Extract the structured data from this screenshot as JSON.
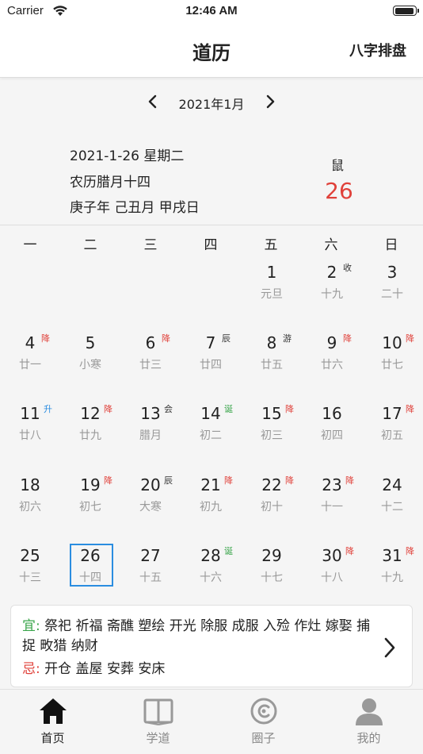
{
  "status_bar": {
    "carrier": "Carrier",
    "time": "12:46 AM"
  },
  "nav": {
    "title": "道历",
    "right_action": "八字排盘"
  },
  "month_bar": {
    "label": "2021年1月"
  },
  "day_info": {
    "solar": "2021-1-26 星期二",
    "lunar": "农历腊月十四",
    "ganzhi": "庚子年 己丑月 甲戌日",
    "zodiac": "鼠",
    "day": "26"
  },
  "weekdays": [
    "一",
    "二",
    "三",
    "四",
    "五",
    "六",
    "日"
  ],
  "calendar": [
    [
      null,
      null,
      null,
      null,
      {
        "day": "1",
        "lunar": "元旦",
        "badge": "",
        "badge_color": ""
      },
      {
        "day": "2",
        "lunar": "十九",
        "badge": "收",
        "badge_color": "black"
      },
      {
        "day": "3",
        "lunar": "二十",
        "badge": "",
        "badge_color": ""
      }
    ],
    [
      {
        "day": "4",
        "lunar": "廿一",
        "badge": "降",
        "badge_color": "red"
      },
      {
        "day": "5",
        "lunar": "小寒",
        "badge": "",
        "badge_color": ""
      },
      {
        "day": "6",
        "lunar": "廿三",
        "badge": "降",
        "badge_color": "red"
      },
      {
        "day": "7",
        "lunar": "廿四",
        "badge": "辰",
        "badge_color": "black"
      },
      {
        "day": "8",
        "lunar": "廿五",
        "badge": "游",
        "badge_color": "black"
      },
      {
        "day": "9",
        "lunar": "廿六",
        "badge": "降",
        "badge_color": "red"
      },
      {
        "day": "10",
        "lunar": "廿七",
        "badge": "降",
        "badge_color": "red"
      }
    ],
    [
      {
        "day": "11",
        "lunar": "廿八",
        "badge": "升",
        "badge_color": "blue"
      },
      {
        "day": "12",
        "lunar": "廿九",
        "badge": "降",
        "badge_color": "red"
      },
      {
        "day": "13",
        "lunar": "腊月",
        "badge": "会",
        "badge_color": "black"
      },
      {
        "day": "14",
        "lunar": "初二",
        "badge": "诞",
        "badge_color": "green"
      },
      {
        "day": "15",
        "lunar": "初三",
        "badge": "降",
        "badge_color": "red"
      },
      {
        "day": "16",
        "lunar": "初四",
        "badge": "",
        "badge_color": ""
      },
      {
        "day": "17",
        "lunar": "初五",
        "badge": "降",
        "badge_color": "red"
      }
    ],
    [
      {
        "day": "18",
        "lunar": "初六",
        "badge": "",
        "badge_color": ""
      },
      {
        "day": "19",
        "lunar": "初七",
        "badge": "降",
        "badge_color": "red"
      },
      {
        "day": "20",
        "lunar": "大寒",
        "badge": "辰",
        "badge_color": "black"
      },
      {
        "day": "21",
        "lunar": "初九",
        "badge": "降",
        "badge_color": "red"
      },
      {
        "day": "22",
        "lunar": "初十",
        "badge": "降",
        "badge_color": "red"
      },
      {
        "day": "23",
        "lunar": "十一",
        "badge": "降",
        "badge_color": "red"
      },
      {
        "day": "24",
        "lunar": "十二",
        "badge": "",
        "badge_color": ""
      }
    ],
    [
      {
        "day": "25",
        "lunar": "十三",
        "badge": "",
        "badge_color": ""
      },
      {
        "day": "26",
        "lunar": "十四",
        "badge": "",
        "badge_color": "",
        "selected": true
      },
      {
        "day": "27",
        "lunar": "十五",
        "badge": "",
        "badge_color": ""
      },
      {
        "day": "28",
        "lunar": "十六",
        "badge": "诞",
        "badge_color": "green"
      },
      {
        "day": "29",
        "lunar": "十七",
        "badge": "",
        "badge_color": ""
      },
      {
        "day": "30",
        "lunar": "十八",
        "badge": "降",
        "badge_color": "red"
      },
      {
        "day": "31",
        "lunar": "十九",
        "badge": "降",
        "badge_color": "red"
      }
    ]
  ],
  "yiji": {
    "yi_label": "宜:",
    "yi_text": "祭祀 祈福 斋醮 塑绘 开光 除服 成服 入殓 作灶 嫁娶 捕捉 畋猎 纳财",
    "ji_label": "忌:",
    "ji_text": "开仓 盖屋 安葬 安床"
  },
  "tabs": [
    {
      "label": "首页",
      "icon": "home-icon",
      "active": true
    },
    {
      "label": "学道",
      "icon": "book-icon",
      "active": false
    },
    {
      "label": "圈子",
      "icon": "circle-icon",
      "active": false
    },
    {
      "label": "我的",
      "icon": "user-icon",
      "active": false
    }
  ],
  "colors": {
    "accent_red": "#e0413a",
    "accent_green": "#3aa54b",
    "accent_blue": "#2b8de0"
  }
}
